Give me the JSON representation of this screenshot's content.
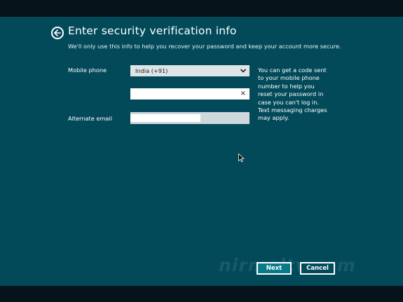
{
  "page": {
    "title": "Enter security verification info",
    "subtitle": "We'll only use this info to help you recover your password and keep your account more secure."
  },
  "form": {
    "mobile_label": "Mobile phone",
    "country_value": "India (+91)",
    "phone_value": "",
    "clear_glyph": "×",
    "email_label": "Alternate email",
    "email_value": ""
  },
  "help_text": "You can get a code sent to your mobile phone number to help you reset your password in case you can't log in. Text messaging charges may apply.",
  "buttons": {
    "next": "Next",
    "cancel": "Cancel"
  },
  "watermark": "nirmaltv.com",
  "colors": {
    "background": "#024a5a",
    "accent": "#0a7a8a",
    "letterbox": "#07131a"
  }
}
